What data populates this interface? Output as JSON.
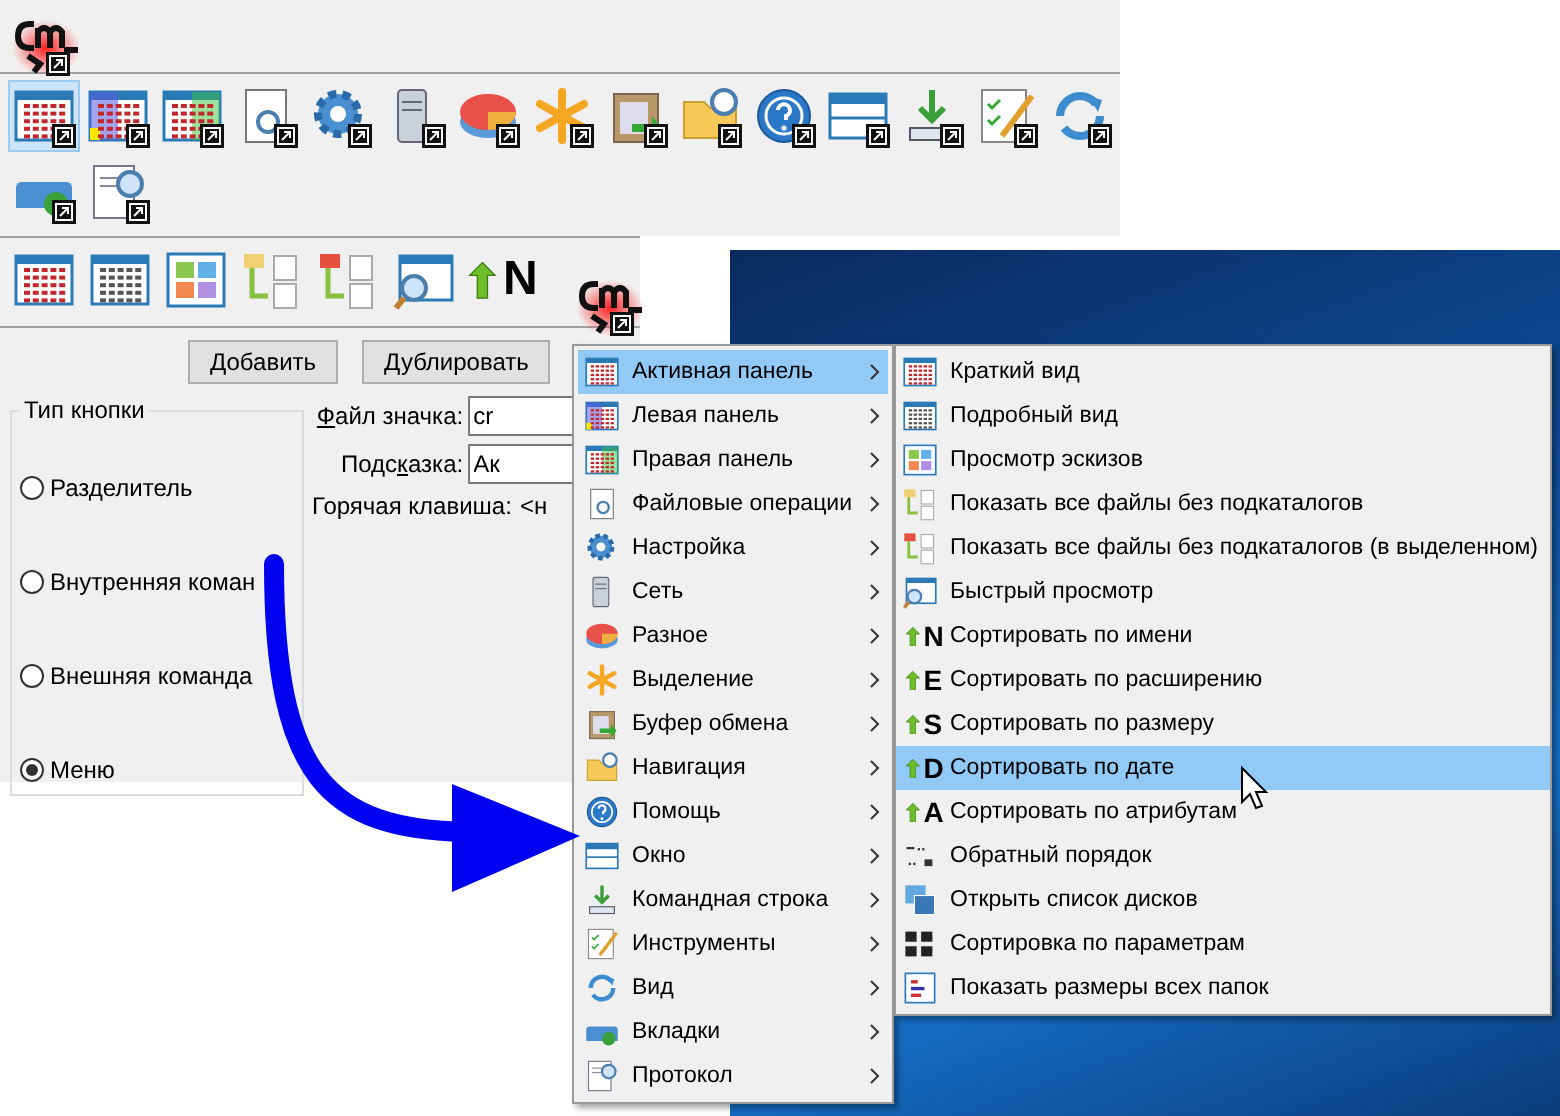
{
  "toolbar_top": {
    "shortcut": true,
    "rows": [
      [
        {
          "selected": true
        },
        {
          "selected": false
        },
        {
          "selected": false
        },
        {
          "selected": false
        },
        {
          "selected": false
        },
        {
          "selected": false
        },
        {
          "selected": false
        },
        {
          "selected": false
        },
        {
          "selected": false
        },
        {
          "selected": false
        },
        {
          "selected": false
        },
        {
          "selected": false
        },
        {
          "selected": false
        },
        {
          "selected": false
        },
        {
          "selected": false
        }
      ],
      [
        {
          "selected": false
        },
        {
          "selected": false
        }
      ]
    ]
  },
  "toolbar_bottom": {
    "sort_glyph": "N"
  },
  "buttons": [
    "Добавить",
    "Дублировать"
  ],
  "button_type": {
    "title": "Тип кнопки",
    "options": [
      {
        "label": "Разделитель",
        "selected": false
      },
      {
        "label": "Внутренняя коман",
        "selected": false
      },
      {
        "label": "Внешняя команда",
        "selected": false
      },
      {
        "label": "Меню",
        "selected": true
      }
    ]
  },
  "fields": [
    {
      "label_key": "Ф",
      "label_post": "айл значка:",
      "value": "cr"
    },
    {
      "label_pre": "Подс",
      "label_key": "к",
      "label_post": "азка:",
      "value": "Ак"
    }
  ],
  "hotkey": {
    "label": "Горячая клавиша:",
    "value": "<н"
  },
  "menu": {
    "items": [
      {
        "label": "Активная панель",
        "selected": true
      },
      {
        "label": "Левая панель",
        "selected": false
      },
      {
        "label": "Правая панель",
        "selected": false
      },
      {
        "label": "Файловые операции",
        "selected": false
      },
      {
        "label": "Настройка",
        "selected": false
      },
      {
        "label": "Сеть",
        "selected": false
      },
      {
        "label": "Разное",
        "selected": false
      },
      {
        "label": "Выделение",
        "selected": false
      },
      {
        "label": "Буфер обмена",
        "selected": false
      },
      {
        "label": "Навигация",
        "selected": false
      },
      {
        "label": "Помощь",
        "selected": false
      },
      {
        "label": "Окно",
        "selected": false
      },
      {
        "label": "Командная строка",
        "selected": false
      },
      {
        "label": "Инструменты",
        "selected": false
      },
      {
        "label": "Вид",
        "selected": false
      },
      {
        "label": "Вкладки",
        "selected": false
      },
      {
        "label": "Протокол",
        "selected": false
      }
    ]
  },
  "submenu": {
    "items": [
      {
        "label": "Краткий вид",
        "selected": false
      },
      {
        "label": "Подробный вид",
        "selected": false
      },
      {
        "label": "Просмотр эскизов",
        "selected": false
      },
      {
        "label": "Показать все файлы без подкаталогов",
        "selected": false
      },
      {
        "label": "Показать все файлы без подкаталогов (в выделенном)",
        "selected": false
      },
      {
        "label": "Быстрый просмотр",
        "selected": false
      },
      {
        "label": "Сортировать по имени",
        "glyph": "N",
        "selected": false
      },
      {
        "label": "Сортировать по расширению",
        "glyph": "E",
        "selected": false
      },
      {
        "label": "Сортировать по размеру",
        "glyph": "S",
        "selected": false
      },
      {
        "label": "Сортировать по дате",
        "glyph": "D",
        "selected": true
      },
      {
        "label": "Сортировать по атрибутам",
        "glyph": "A",
        "selected": false
      },
      {
        "label": "Обратный порядок",
        "selected": false
      },
      {
        "label": "Открыть список дисков",
        "selected": false
      },
      {
        "label": "Сортировка по параметрам",
        "selected": false
      },
      {
        "label": "Показать размеры всех папок",
        "selected": false
      }
    ]
  }
}
